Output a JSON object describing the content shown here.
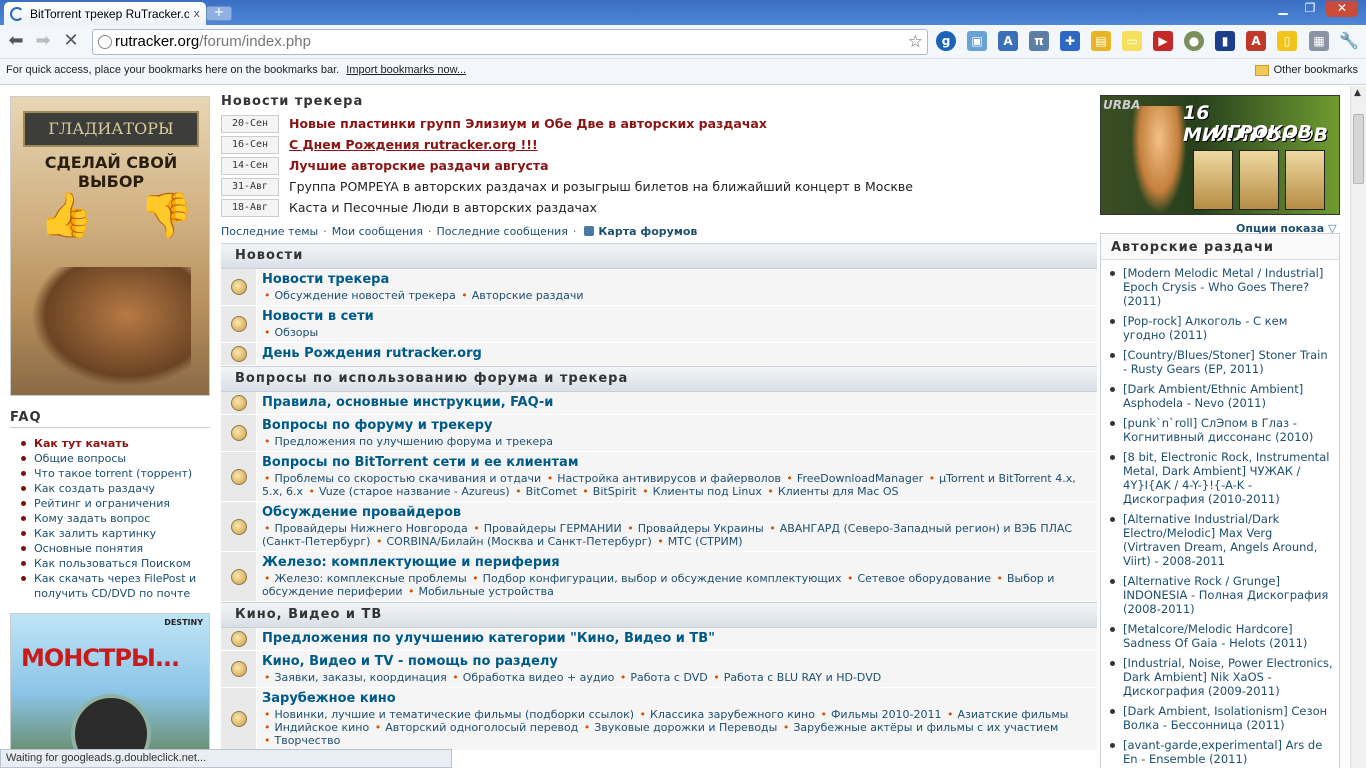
{
  "browser": {
    "tab_title": "BitTorrent трекер RuTracker.o",
    "tab_close": "x",
    "new_tab": "+",
    "url_domain": "rutracker.org",
    "url_path": "/forum/index.php",
    "bookmarks_hint": "For quick access, place your bookmarks here on the bookmarks bar.",
    "import_bookmarks": "Import bookmarks now...",
    "other_bookmarks": "Other bookmarks",
    "status": "Waiting for googleads.g.doubleclick.net..."
  },
  "ads": {
    "gladiators_title": "ГЛАДИАТОРЫ",
    "gladiators_slogan": "СДЕЛАЙ СВОЙ ВЫБОР",
    "monsters_title": "МОНСТРЫ...",
    "monsters_brand": "DESTINY",
    "urban_brand": "URBA",
    "urban_line1": "16 МИЛЛИОНОВ",
    "urban_line2": "ИГРОКОВ"
  },
  "faq": {
    "heading": "FAQ",
    "items": [
      "Как тут качать",
      "Общие вопросы",
      "Что такое torrent (торрент)",
      "Как создать раздачу",
      "Рейтинг и ограничения",
      "Кому задать вопрос",
      "Как залить картинку",
      "Основные понятия",
      "Как пользоваться Поиском",
      "Как скачать через FilePost и получить CD/DVD по почте"
    ]
  },
  "news": {
    "heading": "Новости трекера",
    "items": [
      {
        "date": "20-Сен",
        "text": "Новые пластинки групп Элизиум и Обе Две в авторских раздачах"
      },
      {
        "date": "16-Сен",
        "text": "С Днем Рождения rutracker.org !!!"
      },
      {
        "date": "14-Сен",
        "text": "Лучшие авторские раздачи августа"
      },
      {
        "date": "31-Авг",
        "text": "Группа POMPEYA в авторских раздачах и розыгрыш билетов на ближайший концерт в Москве"
      },
      {
        "date": "18-Авг",
        "text": "Каста и Песочные Люди в авторских раздачах"
      }
    ]
  },
  "quicklinks": {
    "latest_topics": "Последние темы",
    "my_posts": "Мои сообщения",
    "latest_posts": "Последние сообщения",
    "forum_map": "Карта форумов",
    "display_options": "Опции показа"
  },
  "categories": [
    {
      "title": "Новости",
      "forums": [
        {
          "title": "Новости трекера",
          "subs": [
            "Обсуждение новостей трекера",
            "Авторские раздачи"
          ]
        },
        {
          "title": "Новости в сети",
          "subs": [
            "Обзоры"
          ]
        },
        {
          "title": "День Рождения rutracker.org",
          "subs": []
        }
      ]
    },
    {
      "title": "Вопросы по использованию форума и трекера",
      "forums": [
        {
          "title": "Правила, основные инструкции, FAQ-и",
          "subs": []
        },
        {
          "title": "Вопросы по форуму и трекеру",
          "subs": [
            "Предложения по улучшению форума и трекера"
          ]
        },
        {
          "title": "Вопросы по BitTorrent сети и ее клиентам",
          "subs": [
            "Проблемы со скоростью скачивания и отдачи",
            "Настройка антивирусов и файерволов",
            "FreeDownloadManager",
            "µTorrent и BitTorrent 4.x, 5.x, 6.x",
            "Vuze (старое название - Azureus)",
            "BitComet",
            "BitSpirit",
            "Клиенты под Linux",
            "Клиенты для Mac OS"
          ]
        },
        {
          "title": "Обсуждение провайдеров",
          "subs": [
            "Провайдеры Нижнего Новгорода",
            "Провайдеры ГЕРМАНИИ",
            "Провайдеры Украины",
            "АВАНГАРД (Северо-Западный регион) и ВЭБ ПЛАС (Санкт-Петербург)",
            "CORBINA/Билайн (Москва и Санкт-Петербург)",
            "МТС (СТРИМ)"
          ]
        },
        {
          "title": "Железо: комплектующие и периферия",
          "subs": [
            "Железо: комплексные проблемы",
            "Подбор конфигурации, выбор и обсуждение комплектующих",
            "Сетевое оборудование",
            "Выбор и обсуждение периферии",
            "Мобильные устройства"
          ]
        }
      ]
    },
    {
      "title": "Кино, Видео и ТВ",
      "forums": [
        {
          "title": "Предложения по улучшению категории \"Кино, Видео и ТВ\"",
          "subs": []
        },
        {
          "title": "Кино, Видео и ТV - помощь по разделу",
          "subs": [
            "Заявки, заказы, координация",
            "Обработка видео + аудио",
            "Работа с DVD",
            "Работа с BLU RAY и HD-DVD"
          ]
        },
        {
          "title": "Зарубежное кино",
          "subs": [
            "Новинки, лучшие и тематические фильмы (подборки ссылок)",
            "Классика зарубежного кино",
            "Фильмы 2010-2011",
            "Азиатские фильмы",
            "Индийское кино",
            "Авторский одноголосый перевод",
            "Звуковые дорожки и Переводы",
            "Зарубежные актёры и фильмы с их участием",
            "Творчество"
          ]
        }
      ]
    }
  ],
  "author_releases": {
    "heading": "Авторские раздачи",
    "items": [
      "[Modern Melodic Metal / Industrial] Epoch Crysis - Who Goes There? (2011)",
      "[Pop-rock] Алкоголь - С кем угодно (2011)",
      "[Country/Blues/Stoner] Stoner Train - Rusty Gears (EP, 2011)",
      "[Dark Ambient/Ethnic Ambient] Asphodela - Nevo (2011)",
      "[punk`n`roll] СлЭпом в Глаз - Когнитивный диссонанс (2010)",
      "[8 bit, Electronic Rock, Instrumental Metal, Dark Ambient] ЧУЖАК / 4Y}I{AK / 4-Y-}!{-A-K - Дискография (2010-2011)",
      "[Alternative Industrial/Dark Electro/Melodic] Max Verg (Virtraven Dream, Angels Around, Viirt) - 2008-2011",
      "[Alternative Rock / Grunge] INDONESIA - Полная Дискография (2008-2011)",
      "[Metalcore/Melodic Hardcore] Sadness Of Gaia - Helots (2011)",
      "[Industrial, Noise, Power Electronics, Dark Ambient] Nik XaOS - Дискография (2009-2011)",
      "[Dark Ambient, Isolationism] Сезон Волка - Бессонница (2011)",
      "[avant-garde,experimental] Ars de En - Ensemble (2011)"
    ]
  }
}
